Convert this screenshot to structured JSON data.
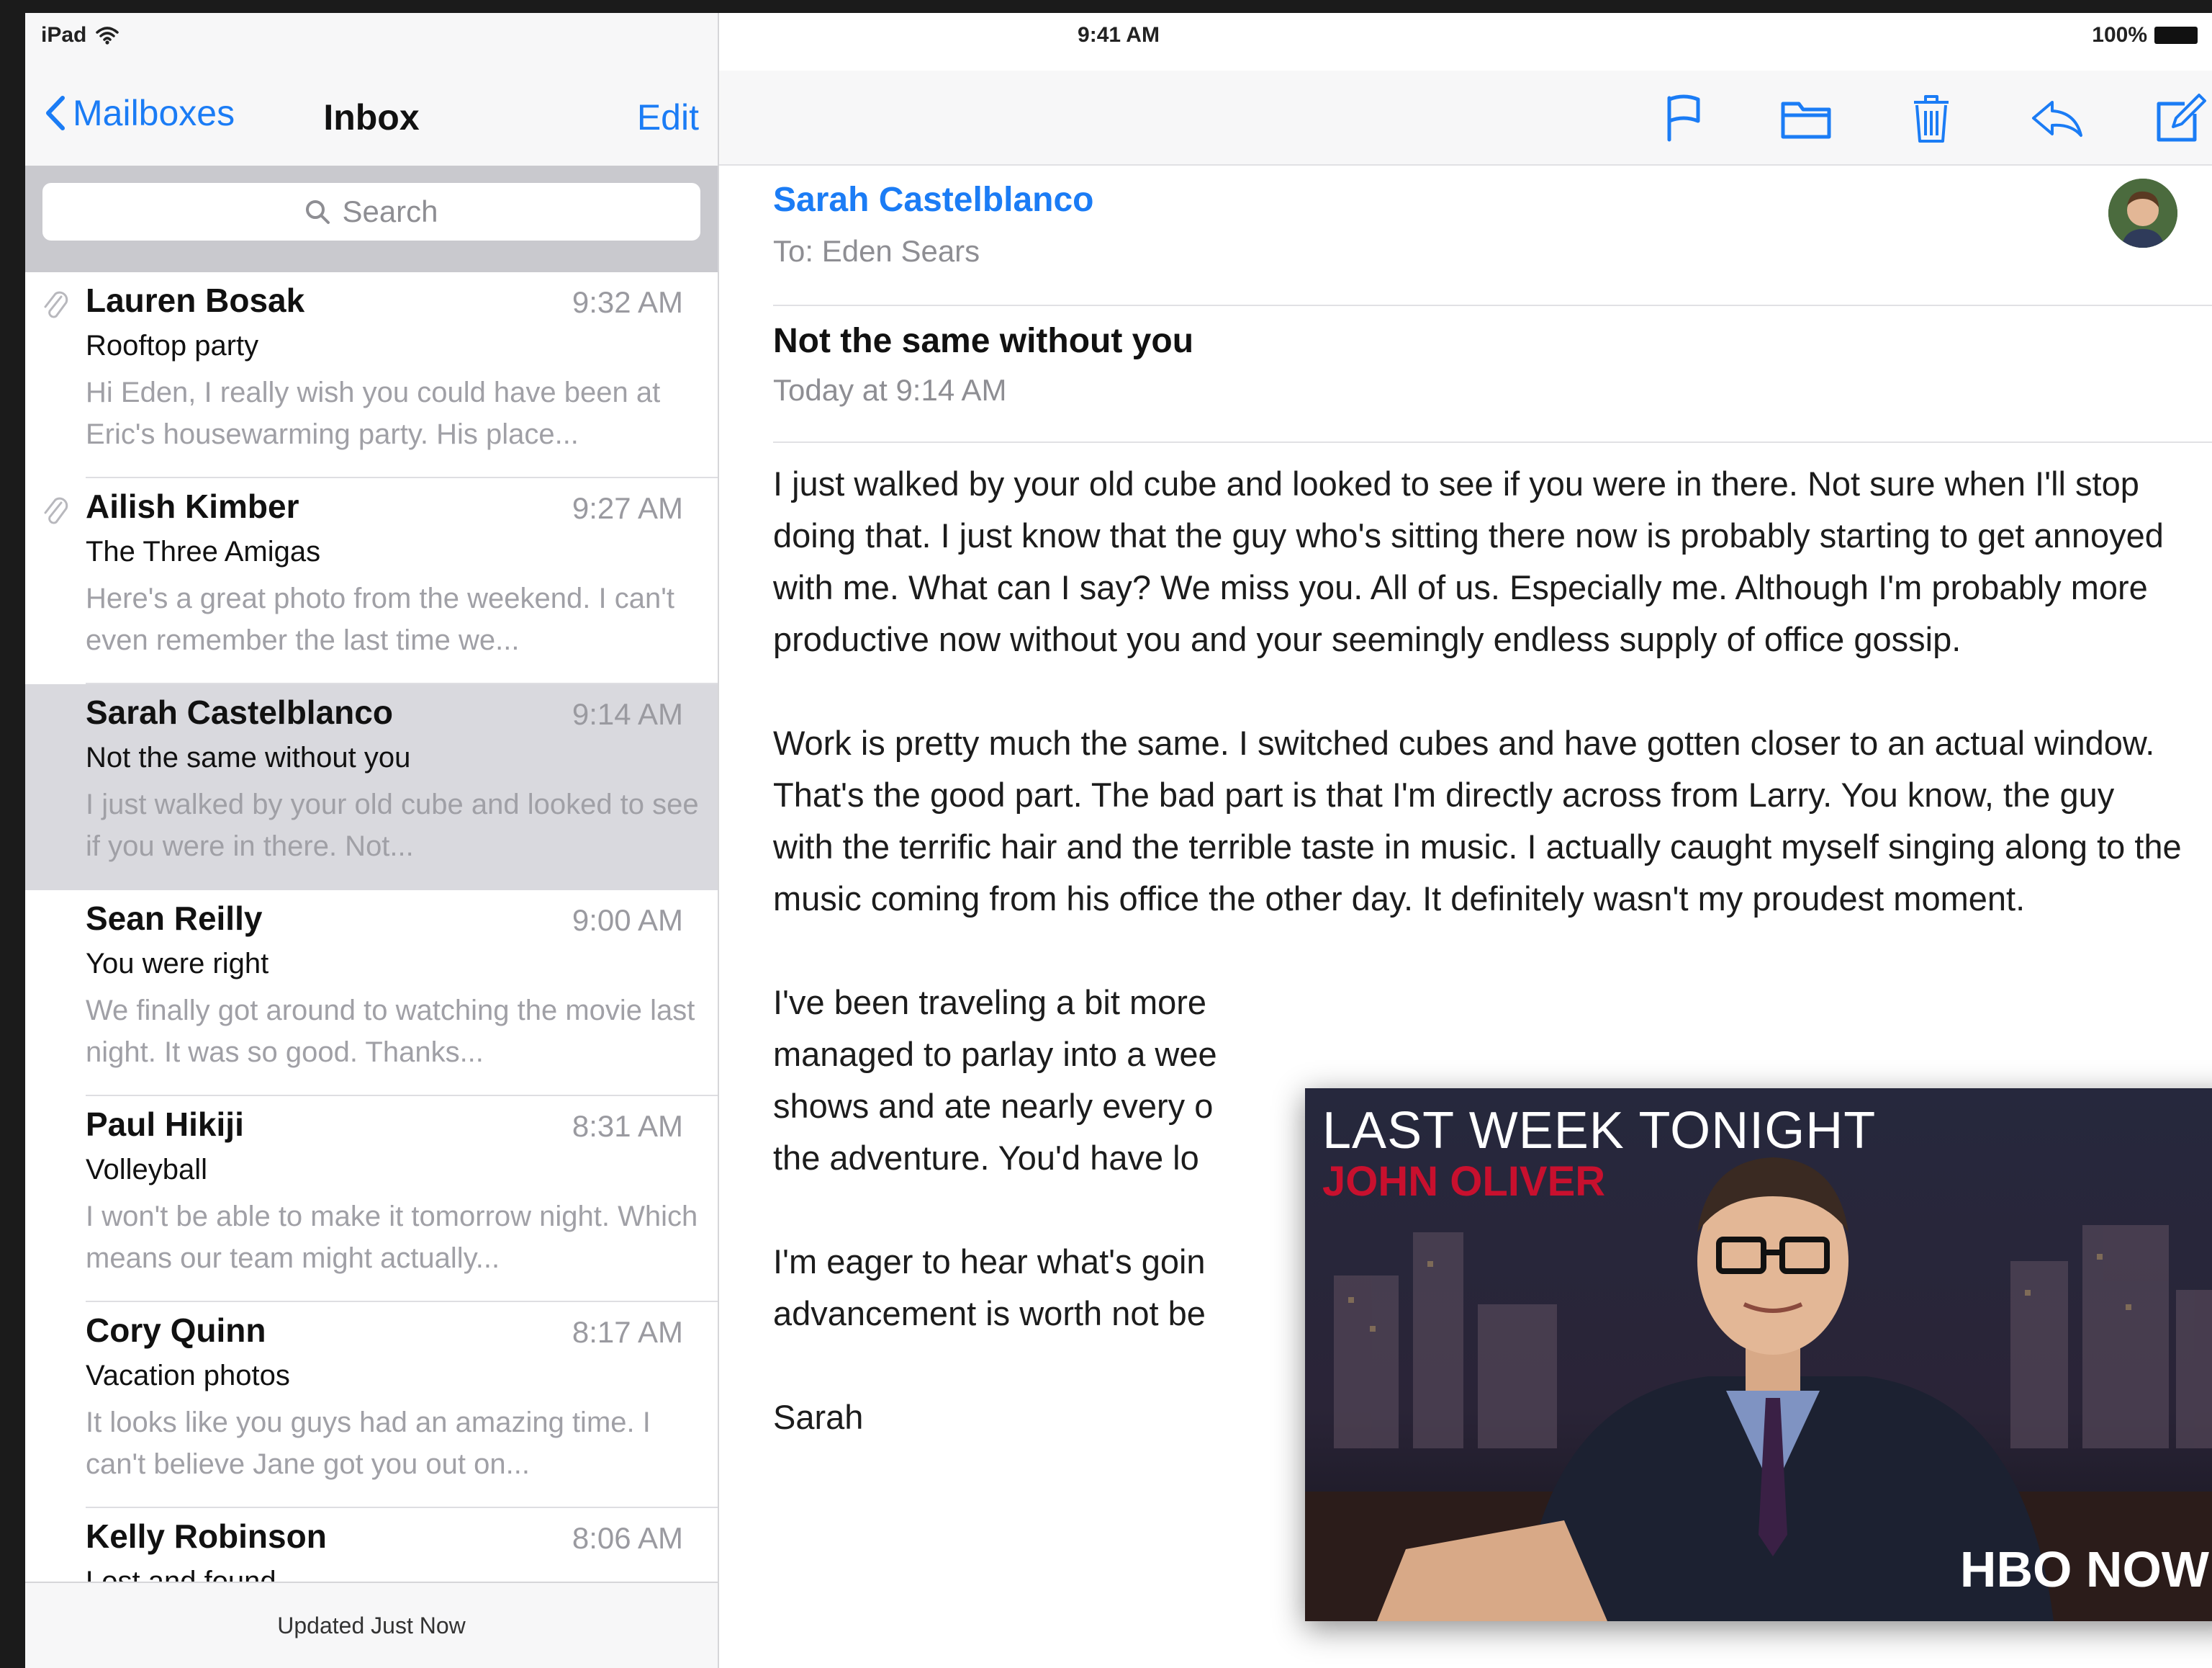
{
  "status_bar": {
    "device": "iPad",
    "time": "9:41 AM",
    "battery": "100%"
  },
  "left_pane": {
    "back_label": "Mailboxes",
    "title": "Inbox",
    "edit_label": "Edit",
    "search_placeholder": "Search",
    "footer": "Updated Just Now",
    "emails": [
      {
        "sender": "Lauren Bosak",
        "time": "9:32 AM",
        "subject": "Rooftop party",
        "preview": "Hi Eden, I really wish you could have been at Eric's housewarming party. His place...",
        "attachment": true
      },
      {
        "sender": "Ailish Kimber",
        "time": "9:27 AM",
        "subject": "The Three Amigas",
        "preview": "Here's a great photo from the weekend. I can't even remember the last time we...",
        "attachment": true
      },
      {
        "sender": "Sarah Castelblanco",
        "time": "9:14 AM",
        "subject": "Not the same without you",
        "preview": "I just walked by your old cube and looked to see if you were in there. Not...",
        "attachment": false
      },
      {
        "sender": "Sean Reilly",
        "time": "9:00 AM",
        "subject": "You were right",
        "preview": "We finally got around to watching the movie last night. It was so good. Thanks...",
        "attachment": false
      },
      {
        "sender": "Paul Hikiji",
        "time": "8:31 AM",
        "subject": "Volleyball",
        "preview": "I won't be able to make it tomorrow night. Which means our team might actually...",
        "attachment": false
      },
      {
        "sender": "Cory Quinn",
        "time": "8:17 AM",
        "subject": "Vacation photos",
        "preview": "It looks like you guys had an amazing time. I can't believe Jane got you out on...",
        "attachment": false
      },
      {
        "sender": "Kelly Robinson",
        "time": "8:06 AM",
        "subject": "Lost and found",
        "preview": "",
        "attachment": false
      }
    ]
  },
  "toolbar": {
    "icons": [
      "flag-icon",
      "folder-icon",
      "trash-icon",
      "reply-icon",
      "compose-icon"
    ],
    "accent": "#1b7cf5"
  },
  "message": {
    "from": "Sarah Castelblanco",
    "to": "To: Eden Sears",
    "subject": "Not the same without you",
    "date": "Today at 9:14 AM",
    "paragraphs": [
      "I just walked by your old cube and looked to see if you were in there. Not sure when I'll stop doing that. I just know that the guy who's sitting there now is probably starting to get annoyed with me. What can I say? We miss you. All of us. Especially me. Although I'm probably more productive now without you and your seemingly endless supply of office gossip.",
      "Work is pretty much the same. I switched cubes and have gotten closer to an actual window. That's the good part. The bad part is that I'm directly across from Larry. You know, the guy with the terrific hair and the terrible taste in music. I actually caught myself singing along to the music coming from his office the other day. It definitely wasn't my proudest moment.",
      "I've been traveling a bit more managed to parlay into a wee shows and ate nearly every o the adventure. You'd have lo",
      "I'm eager to hear what's goin advancement is worth not be",
      "Sarah"
    ]
  },
  "video": {
    "show_title": "LAST WEEK TONIGHT",
    "show_subtitle": "JOHN OLIVER",
    "brand": "HBO NOW"
  }
}
